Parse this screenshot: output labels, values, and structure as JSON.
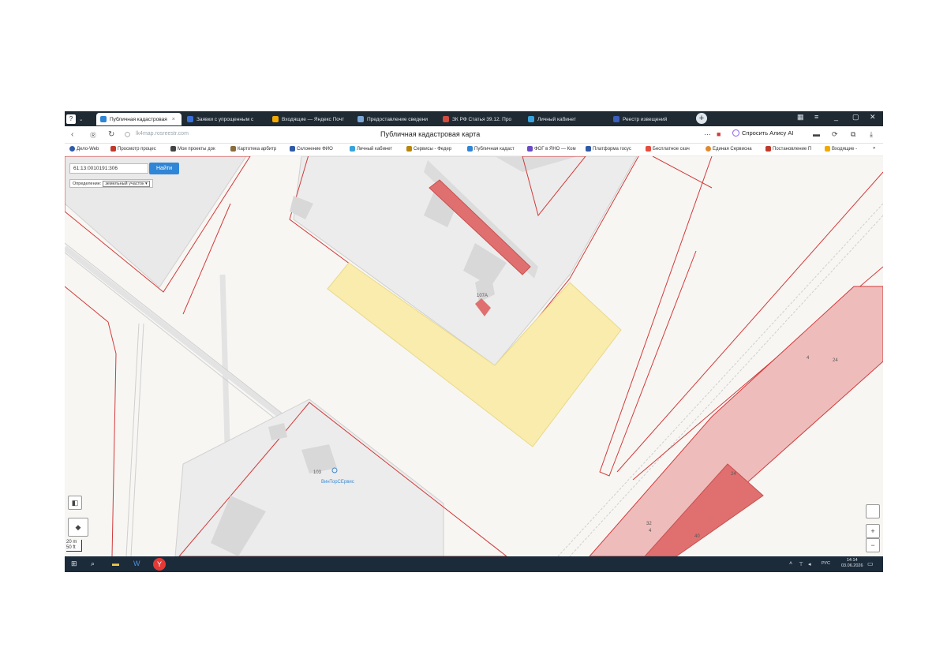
{
  "tabs": [
    {
      "label": "Публичная кадастровая",
      "color": "#2f86d6",
      "active": true
    },
    {
      "label": "Заявки с упрощенным с",
      "color": "#3a6fd8",
      "active": false
    },
    {
      "label": "Входящие — Яндекс Почт",
      "color": "#f2a900",
      "active": false
    },
    {
      "label": "Предоставление сведени",
      "color": "#7aa7d8",
      "active": false
    },
    {
      "label": "ЗК РФ Статья 39.12. Про",
      "color": "#d24b3f",
      "active": false
    },
    {
      "label": "Личный кабинет",
      "color": "#37a3dc",
      "active": false
    },
    {
      "label": "Реестр извещений",
      "color": "#3a5fbf",
      "active": false
    }
  ],
  "address_bar": {
    "url": "lk4map.rosreestr.com",
    "page_title": "Публичная кадастровая карта",
    "alice_label": "Спросить Алису AI"
  },
  "bookmarks": [
    {
      "label": "Дело-Web",
      "color": "#2f5aa8"
    },
    {
      "label": "Просмотр процес",
      "color": "#c0392b"
    },
    {
      "label": "Мои проекты док",
      "color": "#444444"
    },
    {
      "label": "Картотека арбитр",
      "color": "#8a6d3b"
    },
    {
      "label": "Склонение ФИО",
      "color": "#2f5aa8"
    },
    {
      "label": "Личный кабинет",
      "color": "#37a3dc"
    },
    {
      "label": "Сервисы - Федер",
      "color": "#b8860b"
    },
    {
      "label": "Публичная кадаст",
      "color": "#2f86d6"
    },
    {
      "label": "ФОГ в ЯНО — Ком",
      "color": "#6a4bc4"
    },
    {
      "label": "Платформа госус",
      "color": "#2f5aa8"
    },
    {
      "label": "Бесплатное скач",
      "color": "#e74c3c"
    },
    {
      "label": "Единая Сервисна",
      "color": "#e08a2c"
    },
    {
      "label": "Постановление П",
      "color": "#c0392b"
    },
    {
      "label": "Входящие -",
      "color": "#f2a900"
    }
  ],
  "map": {
    "search_value": "61:13:0010191:306",
    "search_button": "Найти",
    "definition_label": "Определение:",
    "definition_value": "земельный участок",
    "labels": {
      "bldg_107a": "107А",
      "bldg_103": "103",
      "poi_name": "ВинТорСЕрвис",
      "num_24a": "24",
      "num_4": "4",
      "num_24b": "24",
      "num_32": "32",
      "num_4b": "4",
      "num_40": "40"
    },
    "scale": {
      "m": "20 m",
      "ft": "50 ft"
    },
    "colors": {
      "cadastral_border": "#d23a3a",
      "selected_parcel": "#f9ecad",
      "building": "#dcdcdc",
      "pink_zone": "#efbcbc",
      "red_zone": "#e07070"
    }
  },
  "taskbar": {
    "lang": "РУС",
    "time": "14:14",
    "date": "03.06.2026"
  }
}
